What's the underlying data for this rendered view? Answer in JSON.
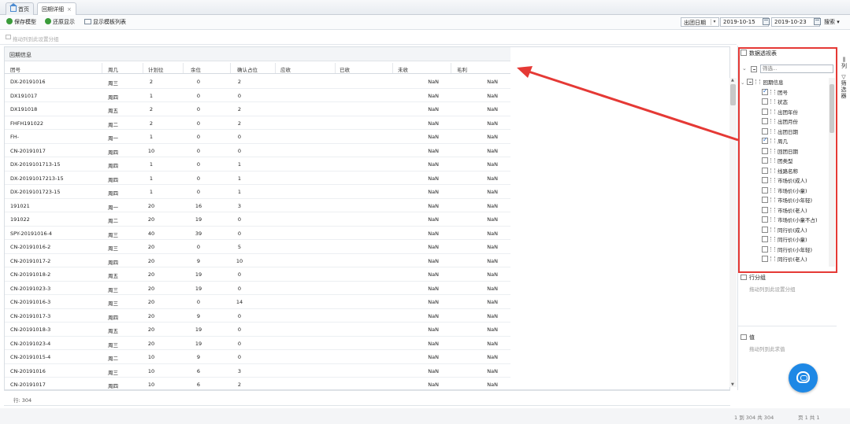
{
  "tabs": [
    {
      "label": "首页",
      "closable": false
    },
    {
      "label": "回期详细",
      "closable": true
    }
  ],
  "toolbar": {
    "save": "保存模型",
    "restore": "还原显示",
    "show_template": "显示模板列表",
    "date_select": "出团日期",
    "date_from": "2019-10-15",
    "date_to": "2019-10-23",
    "search": "搜索"
  },
  "groupbar_hint": "拖动列到此设置分组",
  "panel_title": "回期信息",
  "columns": [
    "团号",
    "周几",
    "计划位",
    "余位",
    "确认占位",
    "应收",
    "已收",
    "未收",
    "毛利"
  ],
  "rows": [
    [
      "DX-20191016",
      "周三",
      "2",
      "0",
      "2",
      "",
      "",
      "NaN",
      "NaN"
    ],
    [
      "DX191017",
      "周四",
      "1",
      "0",
      "0",
      "",
      "",
      "NaN",
      "NaN"
    ],
    [
      "DX191018",
      "周五",
      "2",
      "0",
      "2",
      "",
      "",
      "NaN",
      "NaN"
    ],
    [
      "FHFH191022",
      "周二",
      "2",
      "0",
      "2",
      "",
      "",
      "NaN",
      "NaN"
    ],
    [
      "FH-",
      "周一",
      "1",
      "0",
      "0",
      "",
      "",
      "NaN",
      "NaN"
    ],
    [
      "CN-20191017",
      "周四",
      "10",
      "0",
      "0",
      "",
      "",
      "NaN",
      "NaN"
    ],
    [
      "DX-2019101713-15",
      "周四",
      "1",
      "0",
      "1",
      "",
      "",
      "NaN",
      "NaN"
    ],
    [
      "DX-20191017213-15",
      "周四",
      "1",
      "0",
      "1",
      "",
      "",
      "NaN",
      "NaN"
    ],
    [
      "DX-2019101723-15",
      "周四",
      "1",
      "0",
      "1",
      "",
      "",
      "NaN",
      "NaN"
    ],
    [
      "191021",
      "周一",
      "20",
      "16",
      "3",
      "",
      "",
      "NaN",
      "NaN"
    ],
    [
      "191022",
      "周二",
      "20",
      "19",
      "0",
      "",
      "",
      "NaN",
      "NaN"
    ],
    [
      "SPY-20191016-4",
      "周三",
      "40",
      "39",
      "0",
      "",
      "",
      "NaN",
      "NaN"
    ],
    [
      "CN-20191016-2",
      "周三",
      "20",
      "0",
      "5",
      "",
      "",
      "NaN",
      "NaN"
    ],
    [
      "CN-20191017-2",
      "周四",
      "20",
      "9",
      "10",
      "",
      "",
      "NaN",
      "NaN"
    ],
    [
      "CN-20191018-2",
      "周五",
      "20",
      "19",
      "0",
      "",
      "",
      "NaN",
      "NaN"
    ],
    [
      "CN-20191023-3",
      "周三",
      "20",
      "19",
      "0",
      "",
      "",
      "NaN",
      "NaN"
    ],
    [
      "CN-20191016-3",
      "周三",
      "20",
      "0",
      "14",
      "",
      "",
      "NaN",
      "NaN"
    ],
    [
      "CN-20191017-3",
      "周四",
      "20",
      "9",
      "0",
      "",
      "",
      "NaN",
      "NaN"
    ],
    [
      "CN-20191018-3",
      "周五",
      "20",
      "19",
      "0",
      "",
      "",
      "NaN",
      "NaN"
    ],
    [
      "CN-20191023-4",
      "周三",
      "20",
      "19",
      "0",
      "",
      "",
      "NaN",
      "NaN"
    ],
    [
      "CN-20191015-4",
      "周二",
      "10",
      "9",
      "0",
      "",
      "",
      "NaN",
      "NaN"
    ],
    [
      "CN-20191016",
      "周三",
      "10",
      "6",
      "3",
      "",
      "",
      "NaN",
      "NaN"
    ],
    [
      "CN-20191017",
      "周四",
      "10",
      "6",
      "2",
      "",
      "",
      "NaN",
      "NaN"
    ]
  ],
  "footer": {
    "row_count": "行: 304",
    "range": "1 到 304 共 304",
    "pages": "页 1 共 1"
  },
  "field_panel": {
    "pivot_label": "数据透视表",
    "filter_placeholder": "筛选...",
    "tree_root": "回期信息",
    "fields": [
      {
        "label": "团号",
        "checked": true
      },
      {
        "label": "状态",
        "checked": false
      },
      {
        "label": "出团年份",
        "checked": false
      },
      {
        "label": "出团月份",
        "checked": false
      },
      {
        "label": "出团日期",
        "checked": false
      },
      {
        "label": "周几",
        "checked": true
      },
      {
        "label": "回团日期",
        "checked": false
      },
      {
        "label": "团类型",
        "checked": false
      },
      {
        "label": "线路名称",
        "checked": false
      },
      {
        "label": "市场价(成人)",
        "checked": false
      },
      {
        "label": "市场价(小童)",
        "checked": false
      },
      {
        "label": "市场价(小年轻)",
        "checked": false
      },
      {
        "label": "市场价(老人)",
        "checked": false
      },
      {
        "label": "市场价(小童不占)",
        "checked": false
      },
      {
        "label": "同行价(成人)",
        "checked": false
      },
      {
        "label": "同行价(小童)",
        "checked": false
      },
      {
        "label": "同行价(小年轻)",
        "checked": false
      },
      {
        "label": "同行价(老人)",
        "checked": false
      }
    ],
    "row_group_title": "行分组",
    "row_group_hint": "拖动列到此设置分组",
    "values_title": "值",
    "values_hint": "拖动列到此求值"
  },
  "side_tabs": [
    "列",
    "筛选器"
  ],
  "colors": {
    "accent": "#1e88e5",
    "highlight": "#e53935"
  }
}
